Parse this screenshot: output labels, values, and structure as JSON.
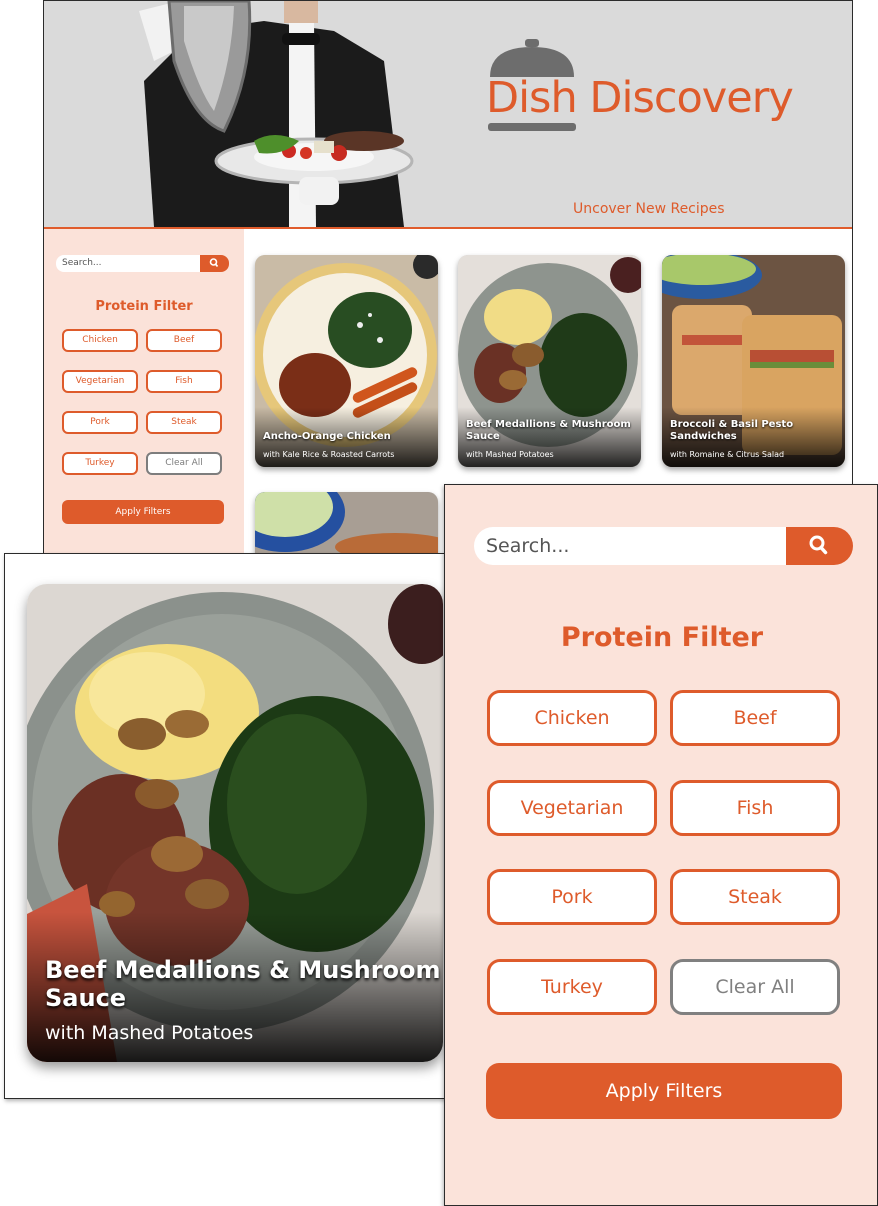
{
  "brand": {
    "name": "Dish Discovery",
    "tagline": "Uncover New Recipes"
  },
  "search": {
    "placeholder": "Search..."
  },
  "filter": {
    "title": "Protein Filter",
    "options": [
      "Chicken",
      "Beef",
      "Vegetarian",
      "Fish",
      "Pork",
      "Steak",
      "Turkey"
    ],
    "clear_label": "Clear All",
    "apply_label": "Apply Filters"
  },
  "recipes": [
    {
      "title": "Ancho-Orange Chicken",
      "subtitle": "with Kale Rice & Roasted Carrots"
    },
    {
      "title": "Beef Medallions & Mushroom Sauce",
      "subtitle": "with Mashed Potatoes"
    },
    {
      "title": "Broccoli & Basil Pesto Sandwiches",
      "subtitle": "with Romaine & Citrus Salad"
    }
  ],
  "zoom_card": {
    "title": "Beef Medallions & Mushroom Sauce",
    "subtitle": "with Mashed Potatoes"
  },
  "colors": {
    "accent": "#de5b2b",
    "sidebar_bg": "#fbe2d9",
    "clear_border": "#7d7d7d",
    "header_bg": "#dadada"
  },
  "icons": {
    "search": "search-icon",
    "logo": "cloche-icon"
  }
}
